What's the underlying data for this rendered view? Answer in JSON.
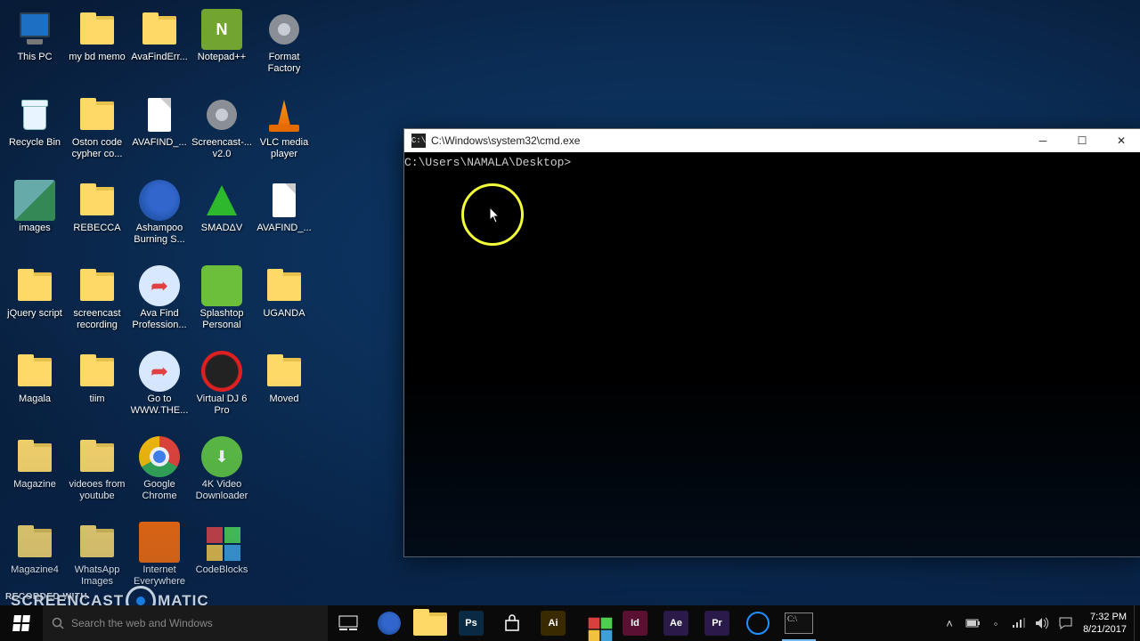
{
  "desktop_icons": [
    {
      "label": "This PC",
      "icon": "monitor"
    },
    {
      "label": "my bd memo",
      "icon": "folder"
    },
    {
      "label": "AvaFindErr...",
      "icon": "folder"
    },
    {
      "label": "Notepad++",
      "icon": "npp"
    },
    {
      "label": "Format Factory",
      "icon": "gear"
    },
    {
      "label": "Recycle Bin",
      "icon": "bin"
    },
    {
      "label": "Oston code cypher co...",
      "icon": "folder"
    },
    {
      "label": "AVAFIND_...",
      "icon": "doc"
    },
    {
      "label": "Screencast-... v2.0",
      "icon": "gear"
    },
    {
      "label": "VLC media player",
      "icon": "vlc"
    },
    {
      "label": "images",
      "icon": "pic"
    },
    {
      "label": "REBECCA",
      "icon": "folder"
    },
    {
      "label": "Ashampoo Burning S...",
      "icon": "edge"
    },
    {
      "label": "SMADΔV",
      "icon": "green-tri"
    },
    {
      "label": "AVAFIND_...",
      "icon": "doc"
    },
    {
      "label": "jQuery script",
      "icon": "folder"
    },
    {
      "label": "screencast recording",
      "icon": "folder"
    },
    {
      "label": "Ava Find Profession...",
      "icon": "arrow"
    },
    {
      "label": "Splashtop Personal",
      "icon": "sq-green"
    },
    {
      "label": "UGANDA",
      "icon": "folder"
    },
    {
      "label": "Magala",
      "icon": "folder"
    },
    {
      "label": "tiim",
      "icon": "folder"
    },
    {
      "label": "Go to WWW.THE...",
      "icon": "arrow"
    },
    {
      "label": "Virtual DJ 6 Pro",
      "icon": "vdj"
    },
    {
      "label": "Moved",
      "icon": "folder"
    },
    {
      "label": "Magazine",
      "icon": "folder"
    },
    {
      "label": "videoes from youtube",
      "icon": "folder"
    },
    {
      "label": "Google Chrome",
      "icon": "chrome"
    },
    {
      "label": "4K Video Downloader",
      "icon": "dk4"
    },
    {
      "label": "",
      "icon": "empty"
    },
    {
      "label": "Magazine4",
      "icon": "folder"
    },
    {
      "label": "WhatsApp Images",
      "icon": "folder"
    },
    {
      "label": "Internet Everywhere",
      "icon": "sq-orange"
    },
    {
      "label": "CodeBlocks",
      "icon": "cb"
    },
    {
      "label": "",
      "icon": "empty"
    }
  ],
  "cmd": {
    "title": "C:\\Windows\\system32\\cmd.exe",
    "prompt": "C:\\Users\\NAMALA\\Desktop>",
    "icon_text": "C:\\"
  },
  "taskbar": {
    "search_placeholder": "Search the web and Windows",
    "pinned": [
      {
        "name": "task-view",
        "type": "svg-taskview"
      },
      {
        "name": "edge",
        "type": "edge"
      },
      {
        "name": "file-explorer",
        "type": "folder"
      },
      {
        "name": "photoshop",
        "type": "badge",
        "text": "Ps",
        "bg": "#0a2a44"
      },
      {
        "name": "store",
        "type": "svg-store"
      },
      {
        "name": "illustrator",
        "type": "badge",
        "text": "Ai",
        "bg": "#3a2a00"
      },
      {
        "name": "office",
        "type": "cb"
      },
      {
        "name": "indesign",
        "type": "badge",
        "text": "Id",
        "bg": "#5a1030"
      },
      {
        "name": "after-effects",
        "type": "badge",
        "text": "Ae",
        "bg": "#2a1a4a"
      },
      {
        "name": "premiere",
        "type": "badge",
        "text": "Pr",
        "bg": "#2a1a4a"
      },
      {
        "name": "screencast",
        "type": "ring"
      },
      {
        "name": "cmd",
        "type": "cmd",
        "active": true
      }
    ],
    "clock": {
      "time": "7:32 PM",
      "date": "8/21/2017"
    }
  },
  "watermark": {
    "line1": "RECORDED WITH",
    "brand_left": "SCREENCAST",
    "brand_right": "MATIC"
  }
}
